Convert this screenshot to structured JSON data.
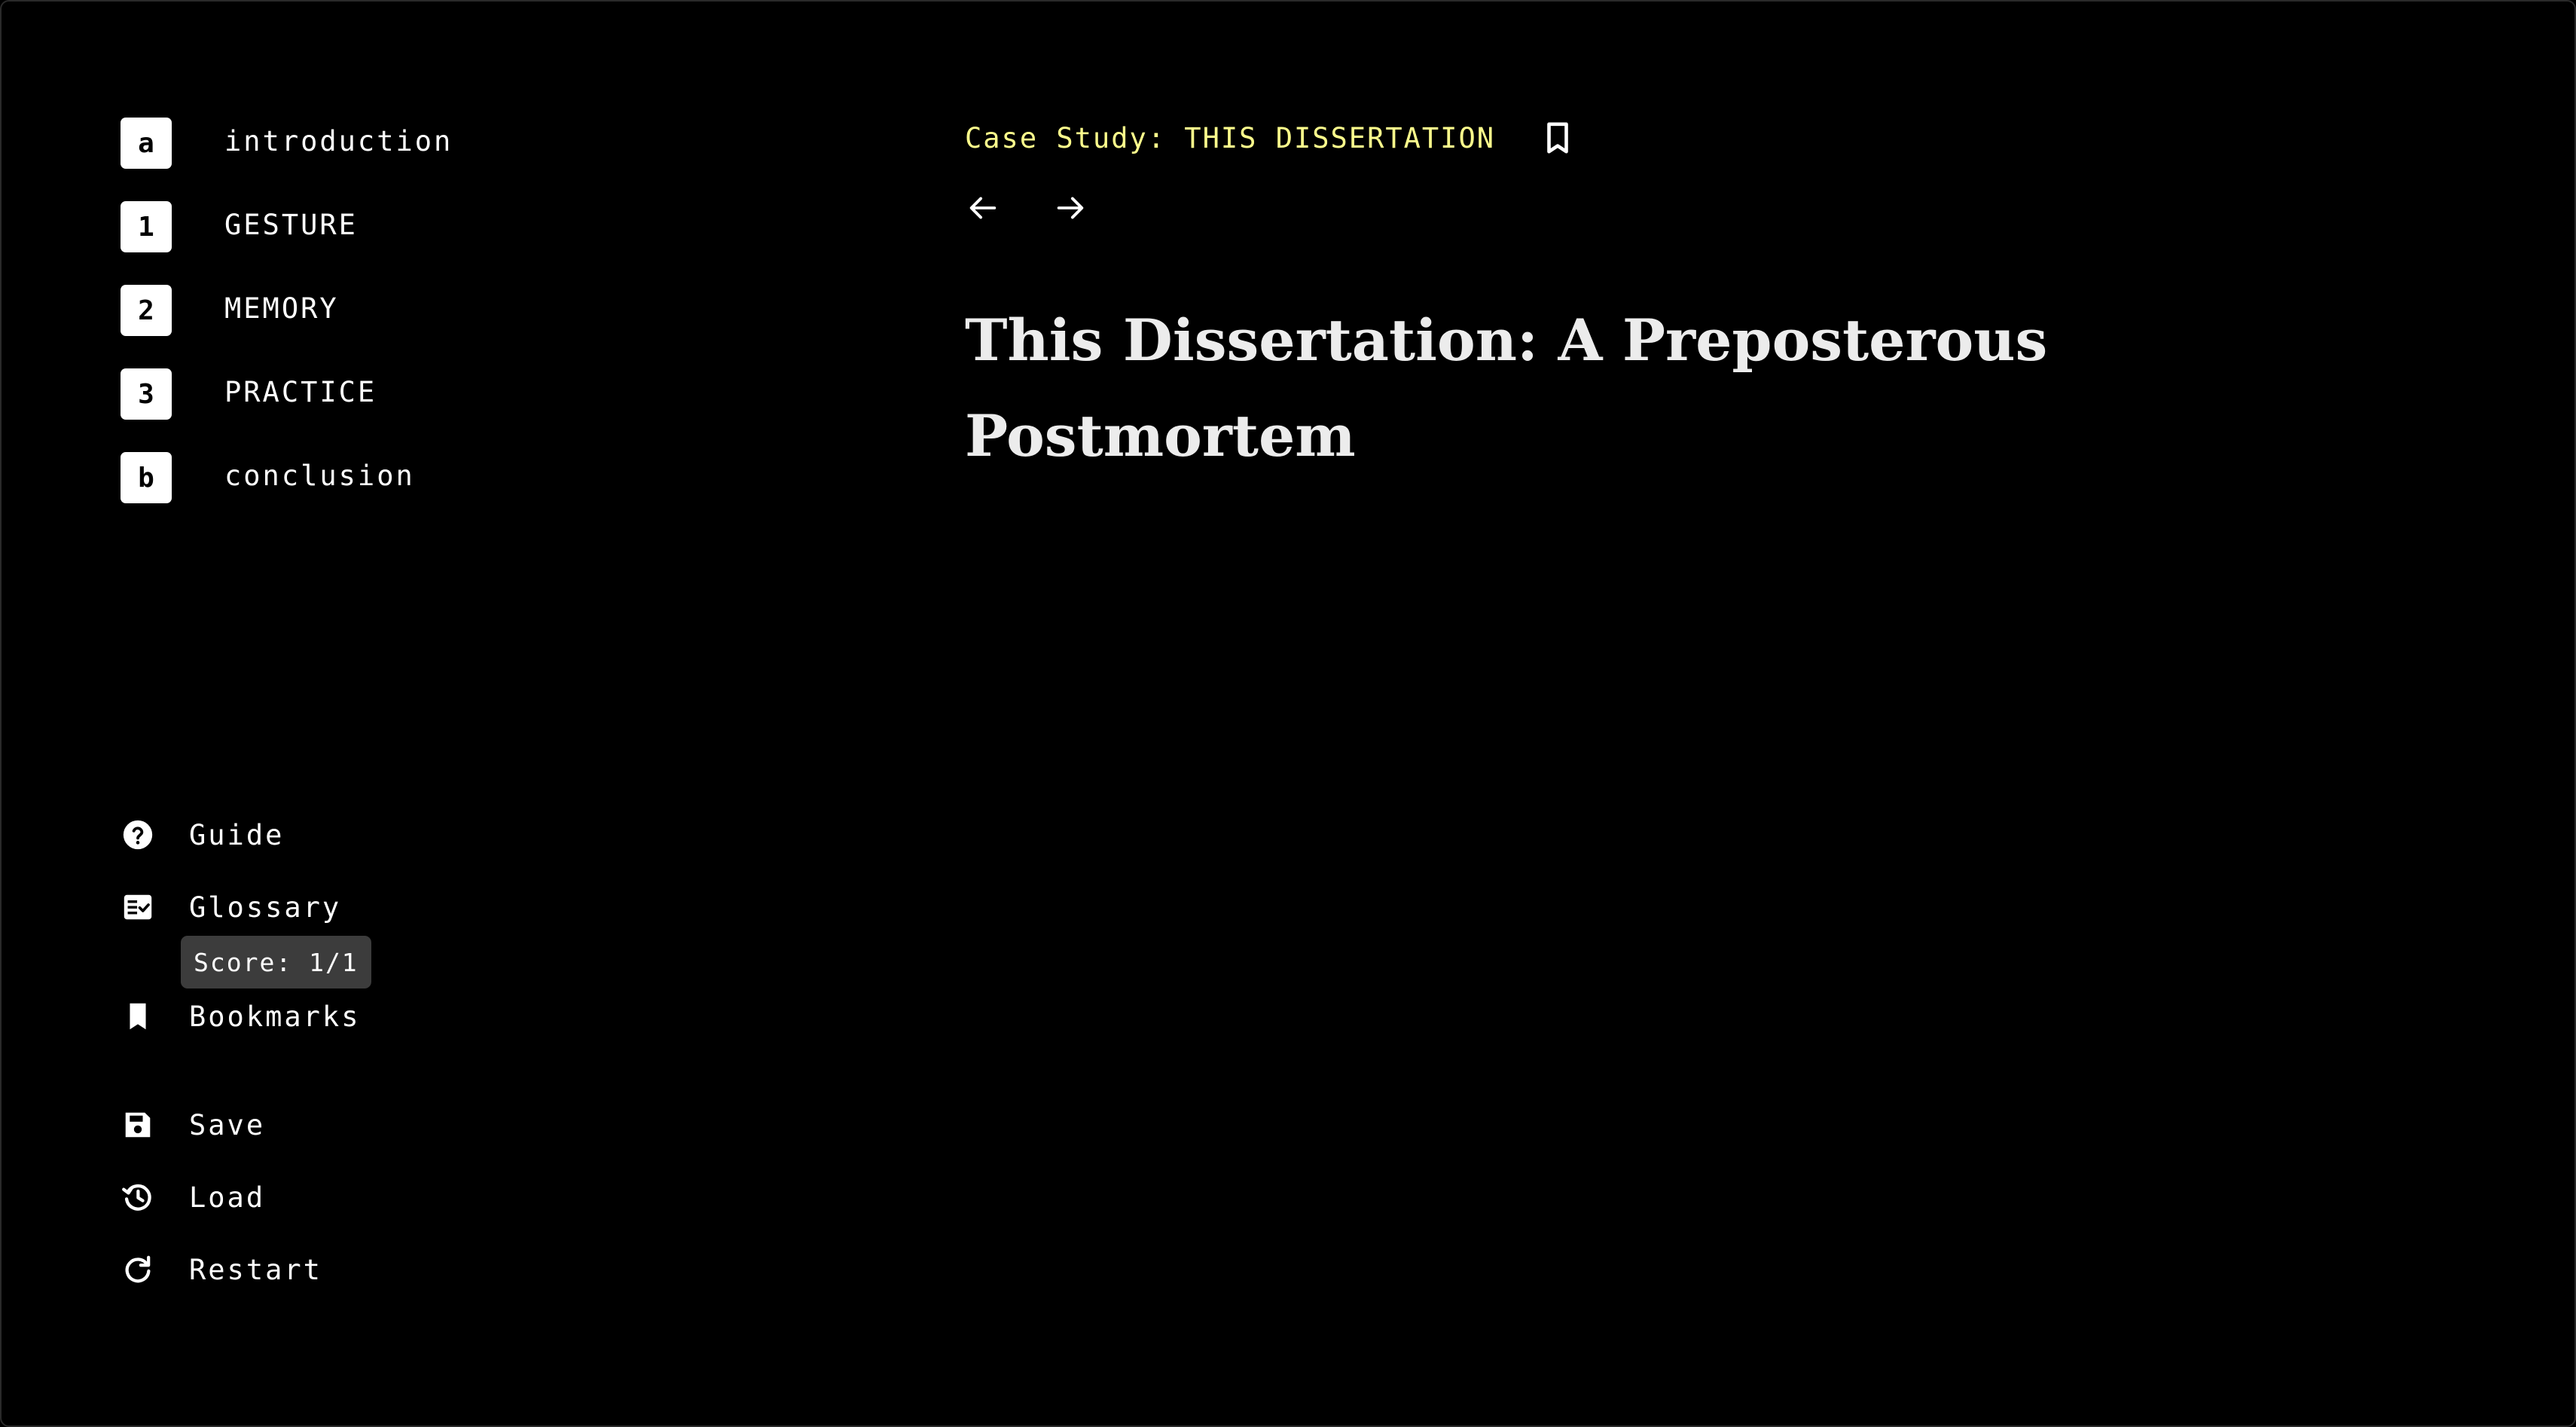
{
  "chapters": [
    {
      "key": "a",
      "label": "introduction"
    },
    {
      "key": "1",
      "label": "GESTURE"
    },
    {
      "key": "2",
      "label": "MEMORY"
    },
    {
      "key": "3",
      "label": "PRACTICE"
    },
    {
      "key": "b",
      "label": "conclusion"
    }
  ],
  "menu": {
    "guide": {
      "label": "Guide",
      "icon": "help-circle-icon"
    },
    "glossary": {
      "label": "Glossary",
      "icon": "checklist-icon"
    },
    "score": "Score: 1/1",
    "bookmarks": {
      "label": "Bookmarks",
      "icon": "bookmark-icon"
    },
    "save": {
      "label": "Save",
      "icon": "save-icon"
    },
    "load": {
      "label": "Load",
      "icon": "history-icon"
    },
    "restart": {
      "label": "Restart",
      "icon": "refresh-icon"
    }
  },
  "main": {
    "case_label": "Case Study: THIS DISSERTATION",
    "bookmark_icon": "bookmark-outline-icon",
    "prev_icon": "arrow-left-icon",
    "next_icon": "arrow-right-icon",
    "title": "This Dissertation: A Preposterous Postmortem"
  },
  "colors": {
    "background": "#000000",
    "text": "#ffffff",
    "accent_yellow": "#ffff8c",
    "score_pill": "#3c3c3c"
  }
}
